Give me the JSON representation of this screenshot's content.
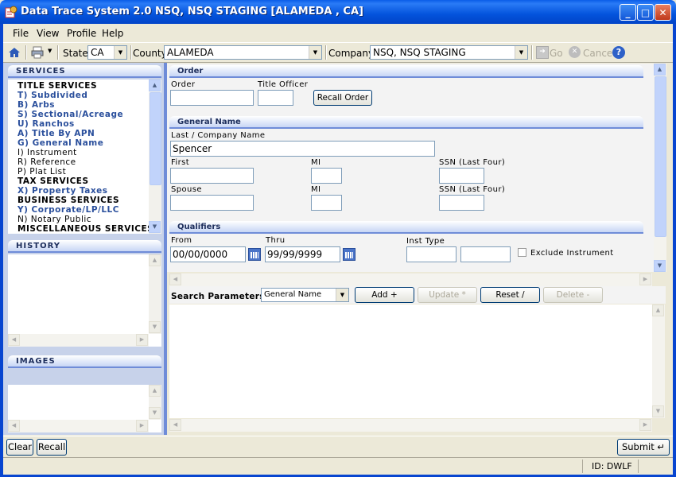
{
  "window": {
    "title": "Data Trace System 2.0 NSQ, NSQ STAGING [ALAMEDA , CA]"
  },
  "menu": [
    "File",
    "View",
    "Profile",
    "Help"
  ],
  "toolbar": {
    "state_label": "State",
    "state_value": "CA",
    "county_label": "County",
    "county_value": "ALAMEDA",
    "company_label": "Company",
    "company_value": "NSQ, NSQ STAGING",
    "go_label": "Go",
    "cancel_label": "Cancel"
  },
  "services": {
    "header": "SERVICES",
    "items": [
      {
        "text": "TITLE SERVICES",
        "kind": "head"
      },
      {
        "text": "T) Subdivided",
        "kind": "link"
      },
      {
        "text": "B) Arbs",
        "kind": "link"
      },
      {
        "text": "S) Sectional/Acreage",
        "kind": "link"
      },
      {
        "text": "U) Ranchos",
        "kind": "link"
      },
      {
        "text": "A) Title By APN",
        "kind": "link"
      },
      {
        "text": "G) General Name",
        "kind": "link"
      },
      {
        "text": "I) Instrument",
        "kind": "plain"
      },
      {
        "text": "R) Reference",
        "kind": "plain"
      },
      {
        "text": "P) Plat List",
        "kind": "plain"
      },
      {
        "text": "TAX SERVICES",
        "kind": "head"
      },
      {
        "text": "X) Property Taxes",
        "kind": "link"
      },
      {
        "text": "BUSINESS SERVICES",
        "kind": "head"
      },
      {
        "text": "Y) Corporate/LP/LLC",
        "kind": "link"
      },
      {
        "text": "N) Notary Public",
        "kind": "plain"
      },
      {
        "text": "MISCELLANEOUS SERVICES",
        "kind": "head"
      }
    ]
  },
  "history": {
    "header": "HISTORY"
  },
  "images": {
    "header": "IMAGES"
  },
  "order": {
    "header": "Order",
    "order_label": "Order",
    "order_value": "",
    "officer_label": "Title Officer",
    "officer_value": "",
    "recall_button": "Recall Order"
  },
  "general_name": {
    "header": "General Name",
    "last_label": "Last / Company Name",
    "last_value": "Spencer",
    "first_label": "First",
    "first_value": "",
    "mi_label": "MI",
    "mi_value": "",
    "ssn_label": "SSN (Last Four)",
    "ssn_value": "",
    "spouse_label": "Spouse",
    "spouse_value": "",
    "spouse_mi_label": "MI",
    "spouse_mi_value": "",
    "spouse_ssn_label": "SSN (Last Four)",
    "spouse_ssn_value": ""
  },
  "qualifiers": {
    "header": "Qualifiers",
    "from_label": "From",
    "from_value": "00/00/0000",
    "thru_label": "Thru",
    "thru_value": "99/99/9999",
    "inst_type_label": "Inst Type",
    "exclude_label": "Exclude Instrument",
    "exclude_checked": false
  },
  "search_params": {
    "label": "Search Parameters",
    "selected": "General Name",
    "add": "Add +",
    "update": "Update *",
    "reset": "Reset /",
    "delete": "Delete -"
  },
  "footer": {
    "clear": "Clear",
    "recall": "Recall",
    "submit": "Submit ↵",
    "status_id": "ID: DWLF"
  }
}
